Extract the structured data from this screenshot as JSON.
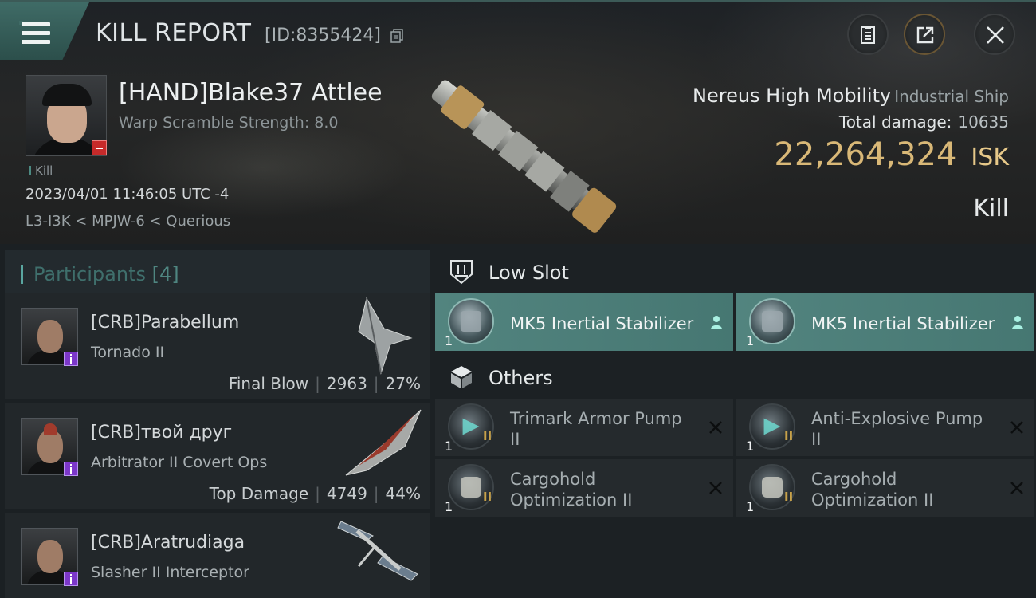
{
  "header": {
    "title": "KILL REPORT",
    "report_id": "[ID:8355424]"
  },
  "victim": {
    "name": "[HAND]Blake37 Attlee",
    "warp_scramble": "Warp Scramble Strength: 8.0",
    "kill_tag": "Kill",
    "timestamp": "2023/04/01 11:46:05 UTC -4",
    "location": "L3-I3K < MPJW-6 < Querious"
  },
  "ship": {
    "name": "Nereus High Mobility",
    "class": "Industrial Ship",
    "total_damage_label": "Total damage:",
    "total_damage_value": "10635",
    "isk_value": "22,264,324",
    "isk_unit": "ISK",
    "result": "Kill"
  },
  "participants": {
    "label": "Participants",
    "count": "[4]",
    "items": [
      {
        "name": "[CRB]Parabellum",
        "ship": "Tornado II",
        "role": "Final Blow",
        "damage": "2963",
        "percent": "27%"
      },
      {
        "name": "[CRB]твой друг",
        "ship": "Arbitrator II Covert Ops",
        "role": "Top Damage",
        "damage": "4749",
        "percent": "44%"
      },
      {
        "name": "[CRB]Aratrudiaga",
        "ship": "Slasher II Interceptor"
      }
    ]
  },
  "fitting": {
    "low_slot": {
      "title": "Low Slot",
      "modules": [
        {
          "qty": "1",
          "name": "MK5 Inertial Stabilizer"
        },
        {
          "qty": "1",
          "name": "MK5 Inertial Stabilizer"
        }
      ]
    },
    "others": {
      "title": "Others",
      "modules": [
        {
          "qty": "1",
          "tier": "II",
          "name": "Trimark Armor Pump II"
        },
        {
          "qty": "1",
          "tier": "II",
          "name": "Anti-Explosive Pump II"
        },
        {
          "qty": "1",
          "tier": "II",
          "name": "Cargohold Optimization II"
        },
        {
          "qty": "1",
          "tier": "II",
          "name": "Cargohold Optimization II"
        }
      ]
    }
  },
  "colors": {
    "accent_teal": "#4f8681",
    "isk_gold": "#d9b877",
    "highlight_row": "#52847f",
    "badge_purple": "#7c37c9",
    "badge_red": "#c62a2a"
  },
  "icons": [
    "menu-icon",
    "copy-icon",
    "clipboard-icon",
    "share-icon",
    "close-icon",
    "low-slot-icon",
    "others-cube-icon",
    "person-icon",
    "x-icon"
  ]
}
